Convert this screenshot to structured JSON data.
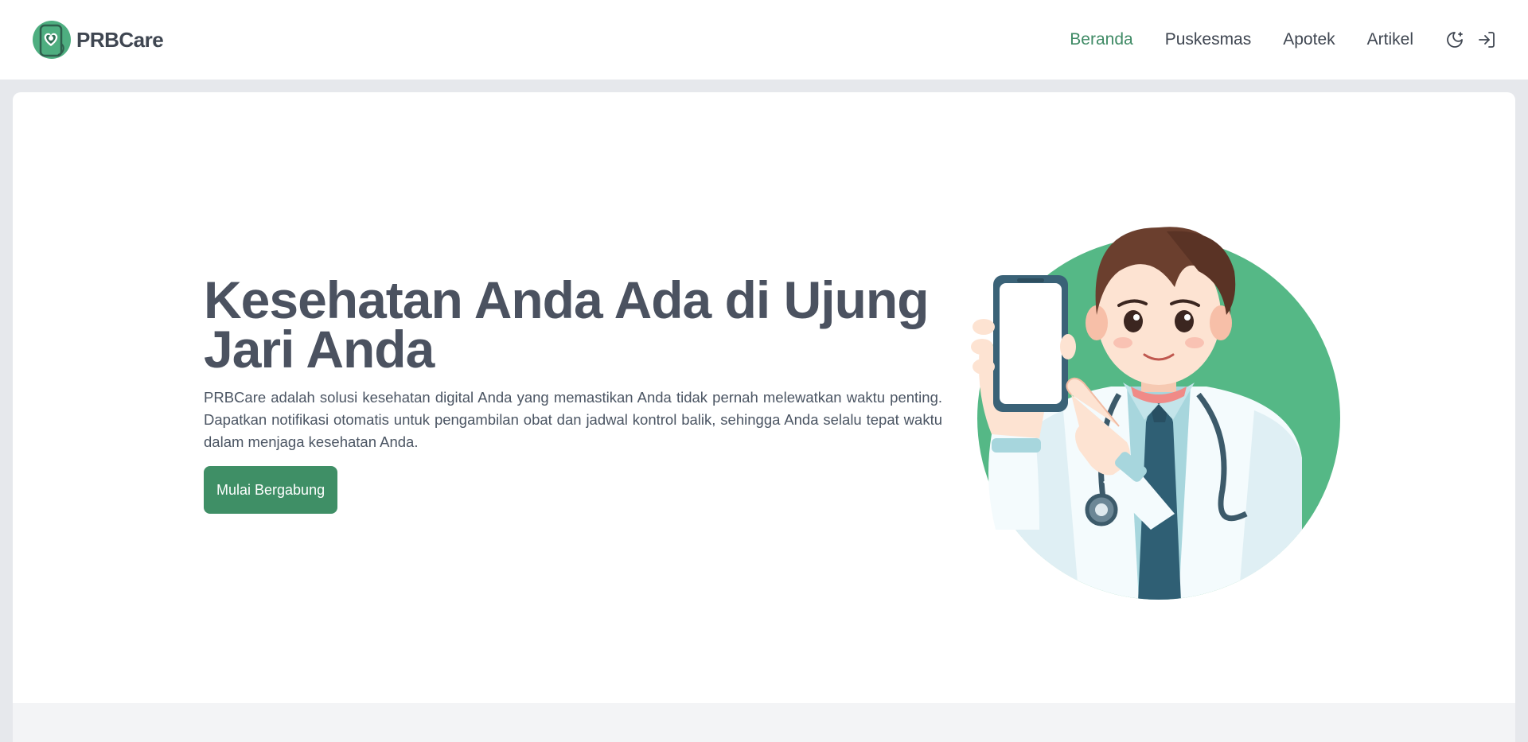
{
  "brand": {
    "name": "PRBCare",
    "logo_icon": "heart-phone-logo-icon"
  },
  "nav": {
    "items": [
      {
        "label": "Beranda",
        "active": true
      },
      {
        "label": "Puskesmas",
        "active": false
      },
      {
        "label": "Apotek",
        "active": false
      },
      {
        "label": "Artikel",
        "active": false
      }
    ],
    "theme_toggle_icon": "moon-icon",
    "login_icon": "login-icon"
  },
  "hero": {
    "title": "Kesehatan Anda Ada di Ujung Jari Anda",
    "description": "PRBCare adalah solusi kesehatan digital Anda yang memastikan Anda tidak pernah melewatkan waktu penting. Dapatkan notifikasi otomatis untuk pengambilan obat dan jadwal kontrol balik, sehingga Anda selalu tepat waktu dalam menjaga kesehatan Anda.",
    "button_label": "Mulai Bergabung",
    "illustration": "doctor-holding-phone-illustration"
  },
  "colors": {
    "accent": "#3f8f66",
    "nav_active": "#3f8a65",
    "circle": "#55b886",
    "page_bg": "#e6e8ec"
  }
}
